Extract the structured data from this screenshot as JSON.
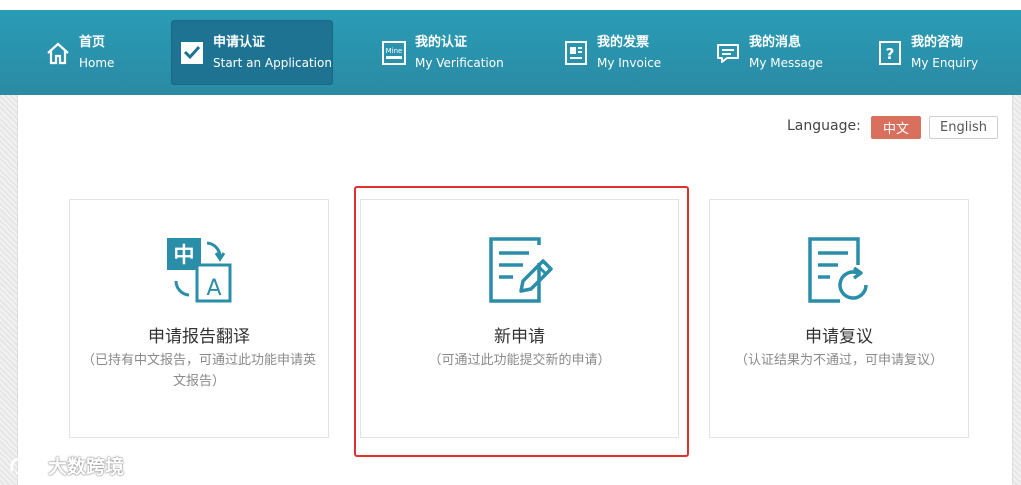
{
  "nav": {
    "items": [
      {
        "cn": "首页",
        "en": "Home",
        "icon": "home-icon"
      },
      {
        "cn": "申请认证",
        "en": "Start an Application",
        "icon": "application-icon",
        "active": true
      },
      {
        "cn": "我的认证",
        "en": "My Verification",
        "icon": "verification-icon",
        "icon_text": "Mine"
      },
      {
        "cn": "我的发票",
        "en": "My Invoice",
        "icon": "invoice-icon"
      },
      {
        "cn": "我的消息",
        "en": "My Message",
        "icon": "message-icon"
      },
      {
        "cn": "我的咨询",
        "en": "My Enquiry",
        "icon": "enquiry-icon",
        "icon_text": "?"
      }
    ]
  },
  "language": {
    "label": "Language:",
    "options": [
      "中文",
      "English"
    ],
    "selected": "中文"
  },
  "cards": [
    {
      "title": "申请报告翻译",
      "desc": "（已持有中文报告，可通过此功能申请英文报告）",
      "icon": "translate-icon",
      "icon_text_cn": "中",
      "icon_text_en": "A"
    },
    {
      "title": "新申请",
      "desc": "（可通过此功能提交新的申请）",
      "icon": "new-application-icon",
      "highlighted": true
    },
    {
      "title": "申请复议",
      "desc": "（认证结果为不通过，可申请复议）",
      "icon": "reconsideration-icon"
    }
  ],
  "watermark": {
    "text": "大数跨境"
  },
  "colors": {
    "nav_bg": "#2a9cb6",
    "nav_active": "#1d7391",
    "icon_teal": "#2a8ea8",
    "lang_active": "#d9705e",
    "highlight_border": "#e02f2f"
  }
}
